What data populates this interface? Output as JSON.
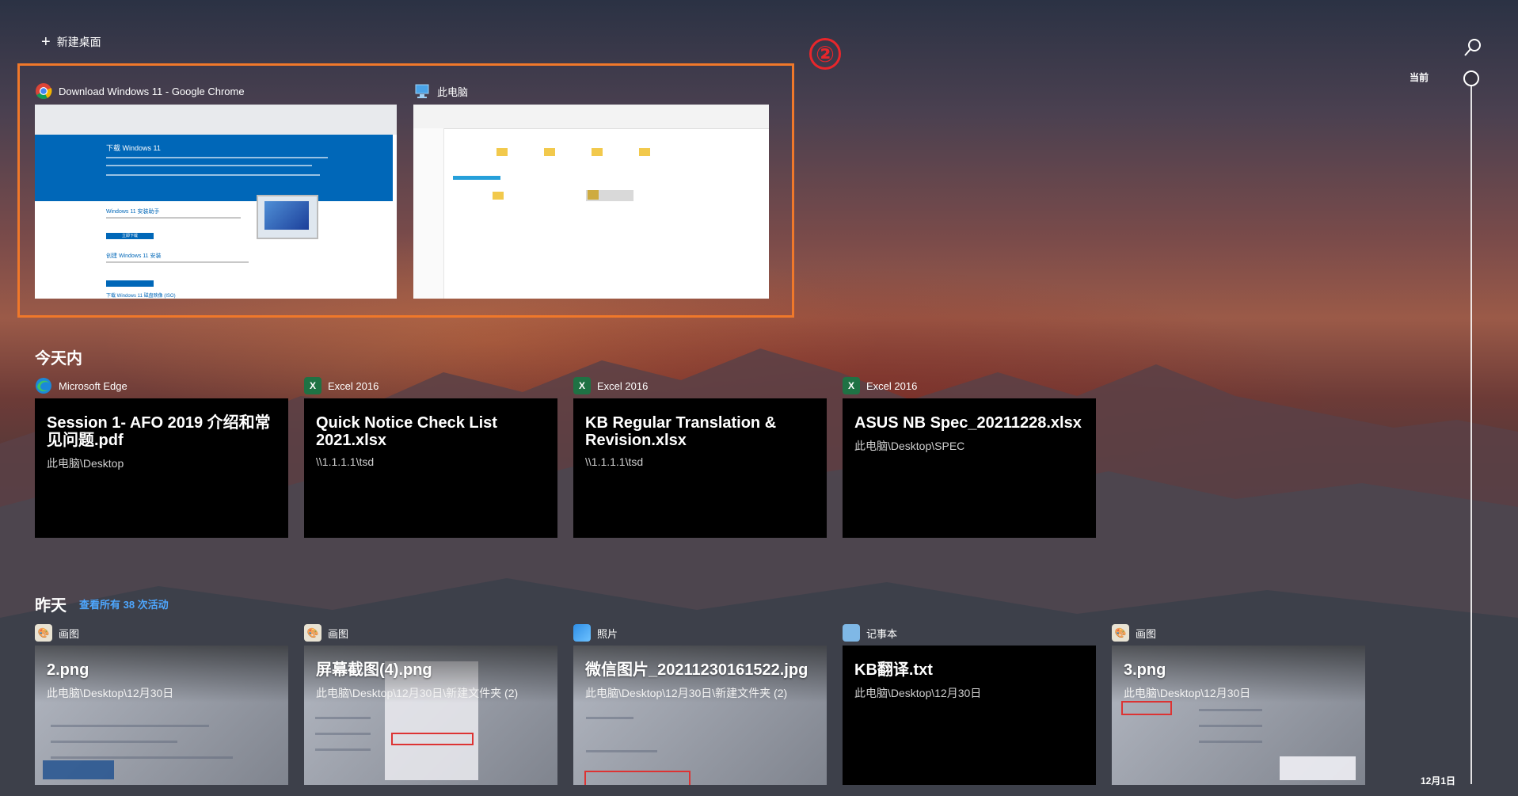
{
  "topbar": {
    "new_desktop_label": "新建桌面"
  },
  "marker": {
    "label": "②"
  },
  "timeline": {
    "current_label": "当前",
    "bottom_date": "12月1日"
  },
  "windows": [
    {
      "title": "Download Windows 11 - Google Chrome",
      "icon": "chrome-icon",
      "preview": {
        "heading": "下载 Windows 11",
        "assistant_heading": "Windows 11 安装助手",
        "media_heading": "创建 Windows 11 安装",
        "iso_heading": "下载 Windows 11 磁盘映像 (ISO)",
        "button": "立即下载"
      }
    },
    {
      "title": "此电脑",
      "icon": "this-pc-icon"
    }
  ],
  "today": {
    "title": "今天内",
    "cards": [
      {
        "app": "Microsoft Edge",
        "icon": "edge-icon",
        "title": "Session 1- AFO 2019 介绍和常见问题.pdf",
        "path": "此电脑\\Desktop"
      },
      {
        "app": "Excel 2016",
        "icon": "excel-icon",
        "title": "Quick Notice Check List 2021.xlsx",
        "path": "\\\\1.1.1.1\\tsd"
      },
      {
        "app": "Excel 2016",
        "icon": "excel-icon",
        "title": "KB Regular Translation & Revision.xlsx",
        "path": "\\\\1.1.1.1\\tsd"
      },
      {
        "app": "Excel 2016",
        "icon": "excel-icon",
        "title": "ASUS NB Spec_20211228.xlsx",
        "path": "此电脑\\Desktop\\SPEC"
      }
    ]
  },
  "yesterday": {
    "title": "昨天",
    "see_all": "查看所有 38 次活动",
    "cards": [
      {
        "app": "画图",
        "icon": "paint-icon",
        "title": "2.png",
        "path": "此电脑\\Desktop\\12月30日"
      },
      {
        "app": "画图",
        "icon": "paint-icon",
        "title": "屏幕截图(4).png",
        "path": "此电脑\\Desktop\\12月30日\\新建文件夹 (2)"
      },
      {
        "app": "照片",
        "icon": "photos-icon",
        "title": "微信图片_20211230161522.jpg",
        "path": "此电脑\\Desktop\\12月30日\\新建文件夹 (2)"
      },
      {
        "app": "记事本",
        "icon": "notepad-icon",
        "title": "KB翻译.txt",
        "path": "此电脑\\Desktop\\12月30日"
      },
      {
        "app": "画图",
        "icon": "paint-icon",
        "title": "3.png",
        "path": "此电脑\\Desktop\\12月30日"
      }
    ]
  },
  "colors": {
    "highlight": "#f0782a",
    "marker": "#e8262b",
    "link": "#4ea7ff",
    "excel": "#1f7244",
    "windows_blue": "#0067b8"
  }
}
